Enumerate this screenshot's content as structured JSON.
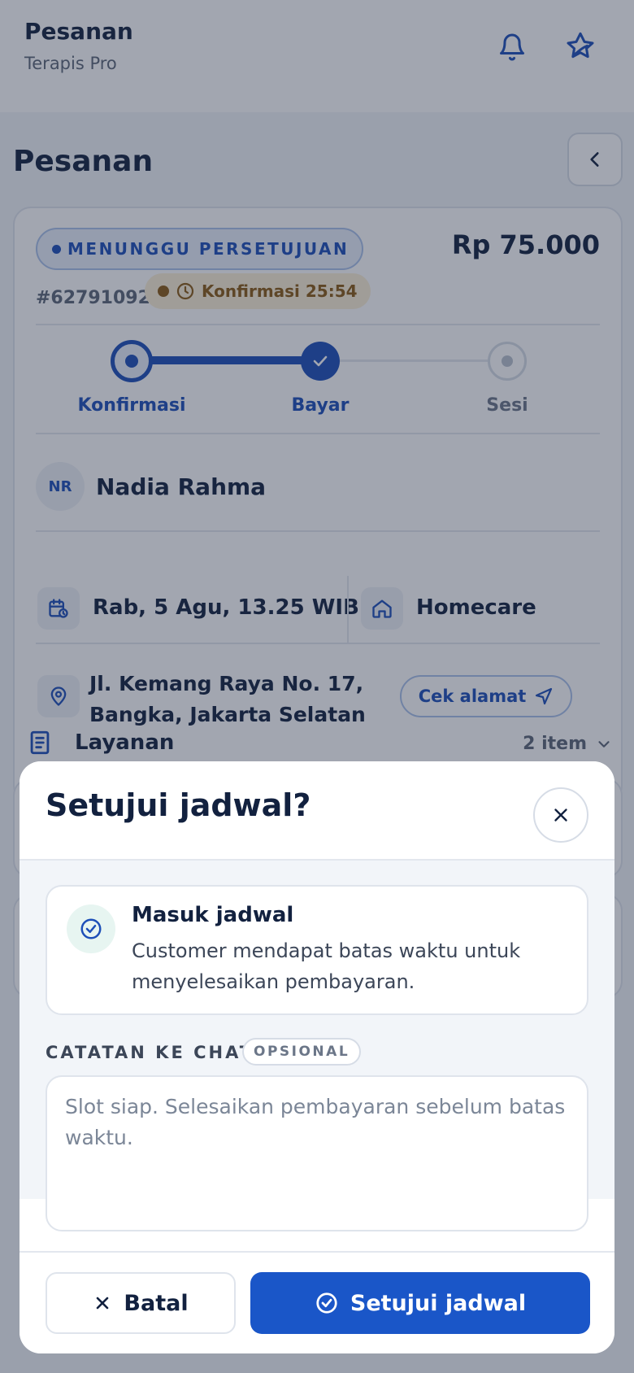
{
  "header": {
    "title": "Pesanan",
    "subtitle": "Terapis Pro",
    "icons": [
      "bell-icon",
      "logo-icon"
    ]
  },
  "page": {
    "title": "Pesanan"
  },
  "order": {
    "status": "MENUNGGU PERSETUJUAN",
    "price": "Rp 75.000",
    "id": "#62791092",
    "timer": "Konfirmasi 25:54",
    "steps": [
      {
        "label": "Konfirmasi",
        "state": "current"
      },
      {
        "label": "Bayar",
        "state": "done"
      },
      {
        "label": "Sesi",
        "state": "upcoming"
      }
    ],
    "client": {
      "initials": "NR",
      "name": "Nadia Rahma"
    },
    "schedule": "Rab, 5 Agu, 13.25 WIB",
    "type": "Homecare",
    "address": "Jl. Kemang Raya No. 17, Bangka, Jakarta Selatan",
    "address_button": "Cek alamat"
  },
  "services": {
    "label": "Layanan",
    "count": "2 item"
  },
  "modal": {
    "title": "Setujui jadwal?",
    "info_title": "Masuk jadwal",
    "info_desc": "Customer mendapat batas waktu untuk menyelesaikan pembayaran.",
    "note_label": "CATATAN KE CHAT",
    "note_badge": "OPSIONAL",
    "note_placeholder": "Slot siap. Selesaikan pembayaran sebelum batas waktu.",
    "cancel_label": "Batal",
    "approve_label": "Setujui jadwal"
  },
  "colors": {
    "primary": "#1a56c8",
    "accent_dark": "#1d4fb8",
    "warning": "#8a5a13",
    "success_bg": "#e7f5f1"
  }
}
